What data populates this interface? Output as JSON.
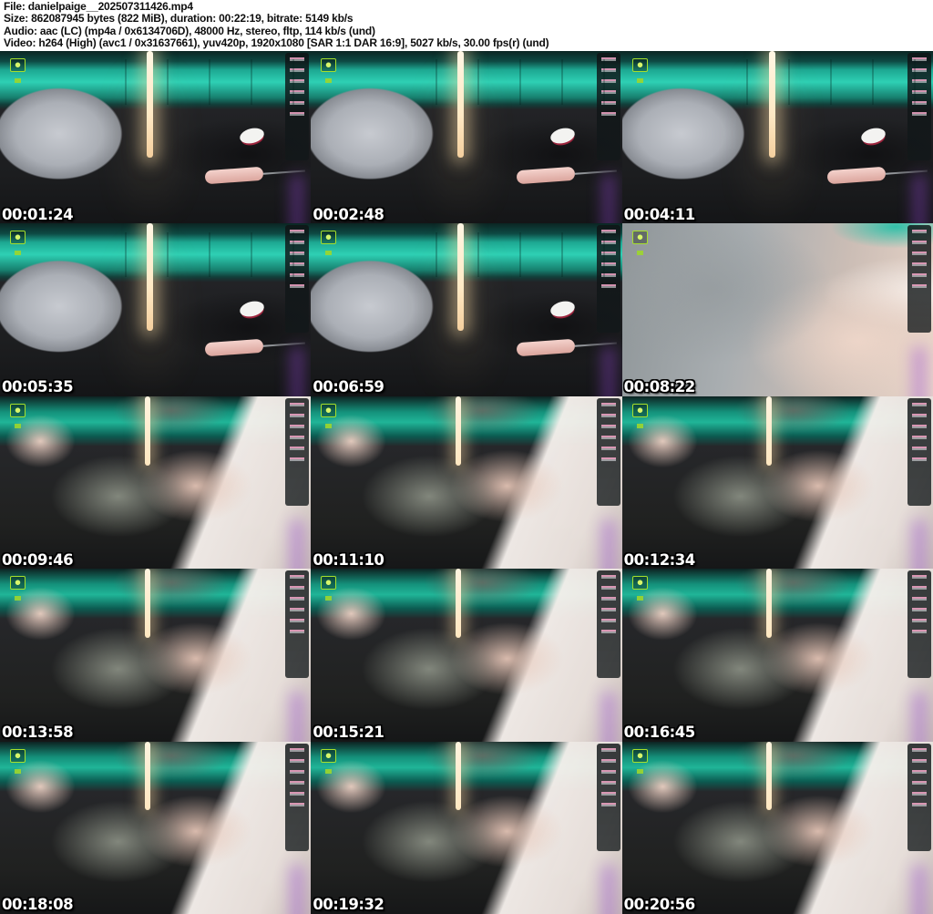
{
  "header": {
    "file": "File: danielpaige__202507311426.mp4",
    "size": "Size: 862087945 bytes (822 MiB), duration: 00:22:19, bitrate: 5149 kb/s",
    "audio": "Audio: aac (LC) (mp4a / 0x6134706D), 48000 Hz, stereo, fltp, 114 kb/s (und)",
    "video": "Video: h264 (High) (avc1 / 0x31637661), yuv420p, 1920x1080 [SAR 1:1 DAR 16:9], 5027 kb/s, 30.00 fps(r) (und)"
  },
  "accent_colors": {
    "teal_glow": "#2ed0b4",
    "warm_light": "#ffe9c4",
    "badge_green": "#a6e02c",
    "seat_dark": "#1d1e20"
  },
  "thumbnails": [
    {
      "timestamp": "00:01:24"
    },
    {
      "timestamp": "00:02:48"
    },
    {
      "timestamp": "00:04:11"
    },
    {
      "timestamp": "00:05:35"
    },
    {
      "timestamp": "00:06:59"
    },
    {
      "timestamp": "00:08:22"
    },
    {
      "timestamp": "00:09:46"
    },
    {
      "timestamp": "00:11:10"
    },
    {
      "timestamp": "00:12:34"
    },
    {
      "timestamp": "00:13:58"
    },
    {
      "timestamp": "00:15:21"
    },
    {
      "timestamp": "00:16:45"
    },
    {
      "timestamp": "00:18:08"
    },
    {
      "timestamp": "00:19:32"
    },
    {
      "timestamp": "00:20:56"
    }
  ]
}
